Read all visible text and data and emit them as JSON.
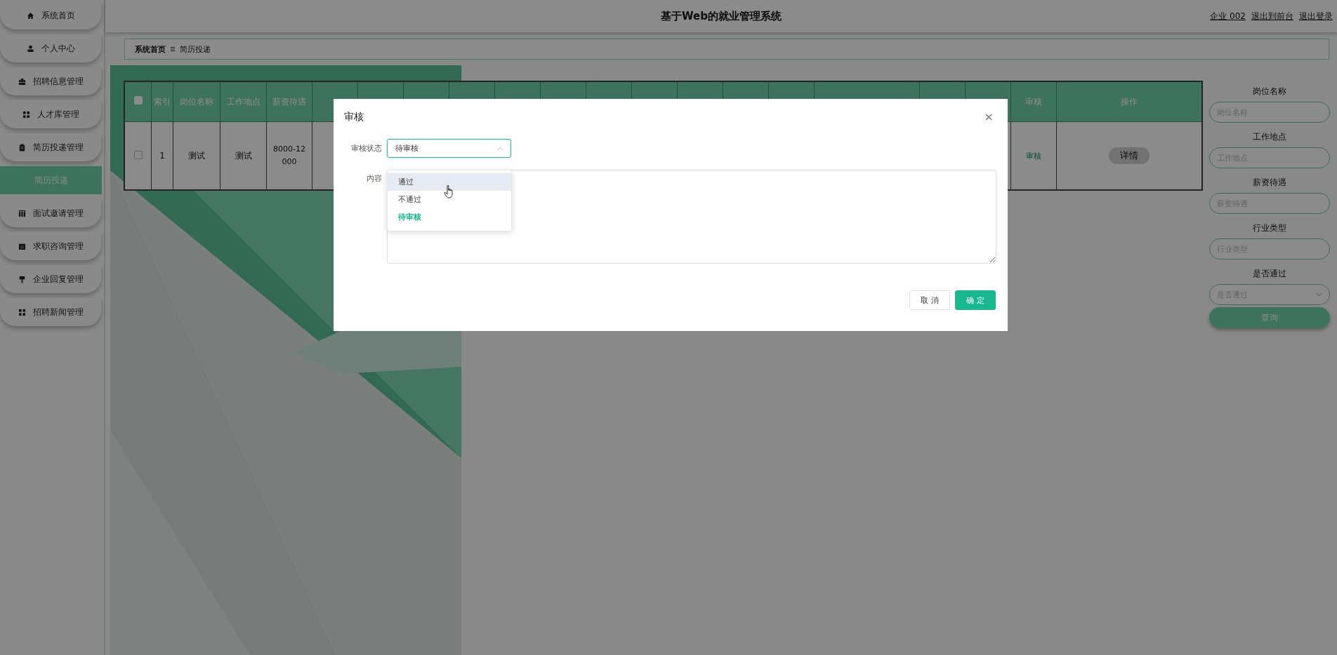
{
  "sidebar": {
    "items": [
      {
        "label": "系统首页",
        "selected": false
      },
      {
        "label": "个人中心",
        "selected": false
      },
      {
        "label": "招聘信息管理",
        "selected": false
      },
      {
        "label": "人才库管理",
        "selected": false
      },
      {
        "label": "简历投递管理",
        "selected": false,
        "children": [
          {
            "label": "简历投递",
            "selected": true
          }
        ]
      },
      {
        "label": "面试邀请管理",
        "selected": false
      },
      {
        "label": "求职咨询管理",
        "selected": false
      },
      {
        "label": "企业回复管理",
        "selected": false
      },
      {
        "label": "招聘新闻管理",
        "selected": false
      }
    ]
  },
  "header": {
    "title": "基于Web的就业管理系统",
    "user": "企业 002",
    "links": [
      "退出到前台",
      "退出登录"
    ]
  },
  "breadcrumb": [
    "系统首页",
    "简历投递"
  ],
  "table": {
    "select_all": {
      "checked": false
    },
    "columns": [
      "索引",
      "岗位名称",
      "工作地点",
      "薪资待遇",
      "审核",
      "操作"
    ],
    "rows": [
      {
        "checked": false,
        "cells": [
          "1",
          "测试",
          "测试",
          "8000-12000"
        ],
        "review": "审核",
        "action": "详情"
      }
    ]
  },
  "search": {
    "fields": [
      {
        "kind": "text",
        "label": "岗位名称",
        "placeholder": "岗位名称"
      },
      {
        "kind": "text",
        "label": "工作地点",
        "placeholder": "工作地点"
      },
      {
        "kind": "text",
        "label": "薪资待遇",
        "placeholder": "薪资待遇"
      },
      {
        "kind": "text",
        "label": "行业类型",
        "placeholder": "行业类型"
      },
      {
        "kind": "select",
        "label": "是否通过",
        "placeholder": "是否通过"
      }
    ],
    "button": "查询"
  },
  "dialog": {
    "title": "审核",
    "close": "×",
    "status_label": "审核状态",
    "status_value": "待审核",
    "expanded": true,
    "options": [
      {
        "label": "通过",
        "selected": false,
        "hovered": true
      },
      {
        "label": "不通过",
        "selected": false,
        "hovered": false
      },
      {
        "label": "待审核",
        "selected": true,
        "hovered": false
      }
    ],
    "content_label": "内容",
    "buttons": {
      "cancel": "取 消",
      "confirm": "确 定"
    }
  }
}
